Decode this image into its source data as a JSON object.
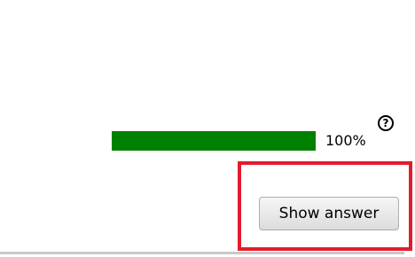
{
  "progress": {
    "value_percent": 100,
    "text": "100%",
    "fill_color": "#008000"
  },
  "help": {
    "glyph": "?",
    "icon": "question-circle-icon"
  },
  "actions": {
    "show_answer_label": "Show answer"
  },
  "highlight": {
    "color": "#e31c2c"
  }
}
